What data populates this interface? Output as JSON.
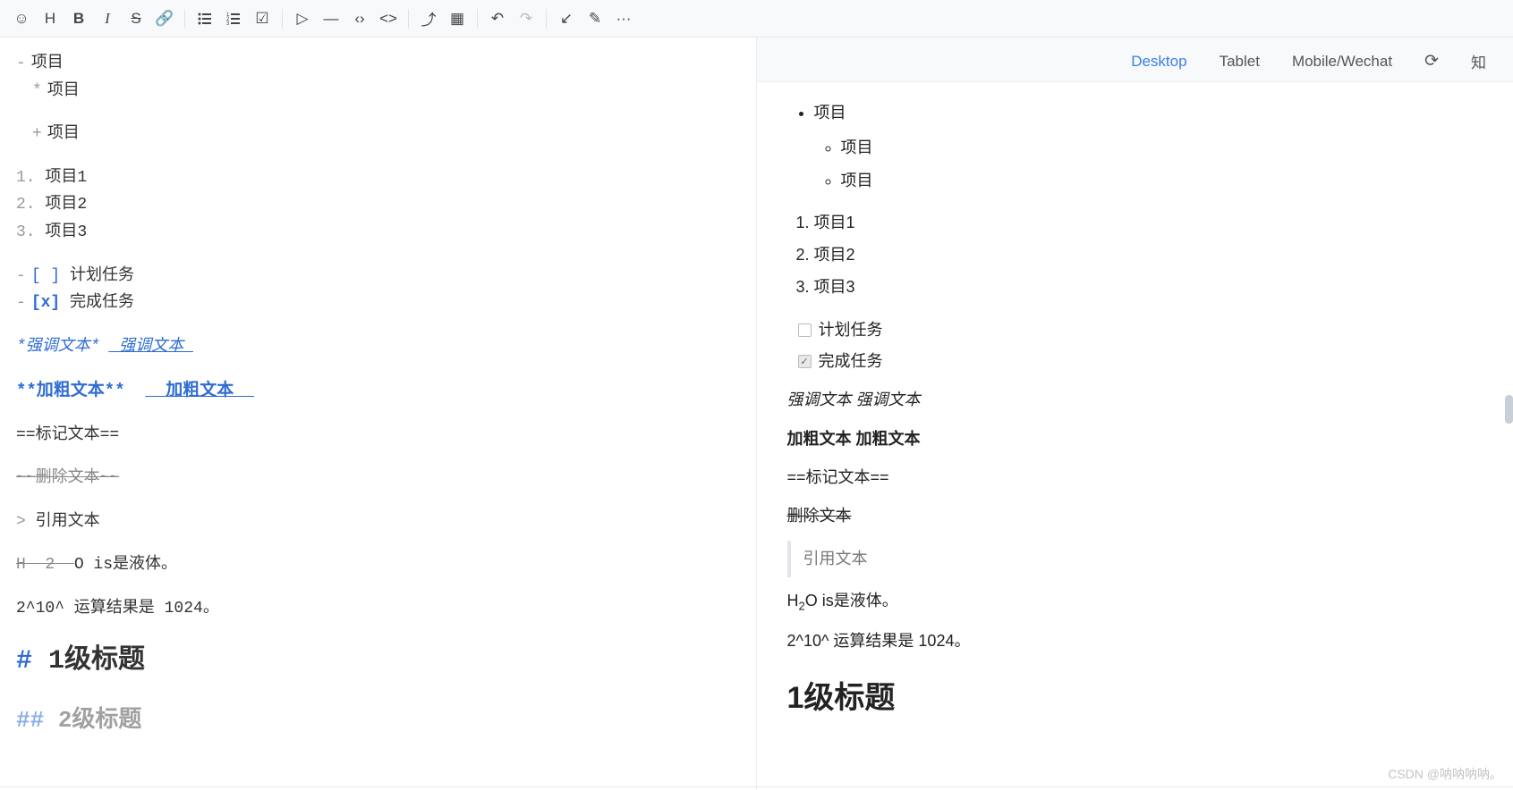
{
  "toolbar": {
    "emoji": "☺",
    "heading": "H",
    "bold": "B",
    "italic": "I",
    "strike": "S",
    "link": "🔗",
    "ul": "≣",
    "ol": "≡",
    "check": "☑",
    "paragraph": "▷",
    "hr": "—",
    "codeInline": "‹›",
    "codeBlock": "<>",
    "table": "▦",
    "upload": "⤴",
    "sync": "⟳",
    "undo": "↶",
    "redo": "↷",
    "exitFull": "↙",
    "edit": "✎",
    "more": "···"
  },
  "editor": {
    "bullet1": "项目",
    "bullet1a": "项目",
    "bullet1b": "项目",
    "ol": [
      "项目1",
      "项目2",
      "项目3"
    ],
    "task1_marker": "[ ]",
    "task1": "计划任务",
    "task2_marker": "[x]",
    "task2": "完成任务",
    "em_src1": "*强调文本*",
    "em_src2": "_强调文本_",
    "bold_src1": "**加粗文本**",
    "bold_src2": "__加粗文本__",
    "mark_src": "==标记文本==",
    "del_src": "~~删除文本~~",
    "quote_src": "引用文本",
    "h2o_src": "H~2~O is是液体。",
    "power_src": "2^10^ 运算结果是 1024。",
    "h1_text": "1级标题",
    "h2_text": "2级标题"
  },
  "previewTabs": {
    "desktop": "Desktop",
    "tablet": "Tablet",
    "mobile": "Mobile/Wechat",
    "refresh": "⟳",
    "zhi": "知"
  },
  "preview": {
    "bullet": "项目",
    "bullet_sub1": "项目",
    "bullet_sub2": "项目",
    "ol": [
      "项目1",
      "项目2",
      "项目3"
    ],
    "task1": "计划任务",
    "task2": "完成任务",
    "em": "强调文本 强调文本",
    "bold": "加粗文本 加粗文本",
    "mark": "==标记文本==",
    "del": "删除文本",
    "quote": "引用文本",
    "h2o_pre": "H",
    "h2o_sub": "2",
    "h2o_post": "O is是液体。",
    "power": "2^10^ 运算结果是 1024。",
    "h1": "1级标题"
  },
  "watermark": "CSDN @呐呐呐呐。"
}
